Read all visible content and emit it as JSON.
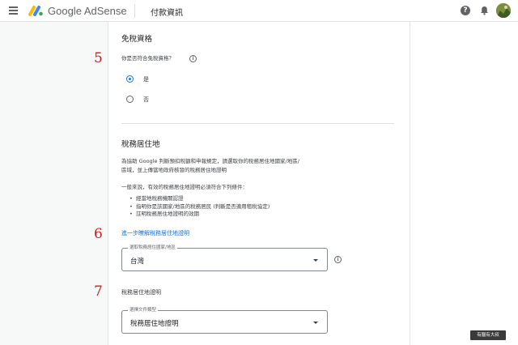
{
  "header": {
    "brand_google": "Google",
    "brand_product": "AdSense",
    "page_title": "付款資訊",
    "help_glyph": "?"
  },
  "tax_exempt": {
    "step_number": "5",
    "heading": "免稅資格",
    "question": "你是否符合免稅資格？",
    "info_glyph": "i",
    "options": [
      {
        "label": "是",
        "selected": true
      },
      {
        "label": "否",
        "selected": false
      }
    ]
  },
  "tax_residence": {
    "heading": "稅務居住地",
    "description_line1": "為協助 Google 判斷預扣稅額和申報規定，請選取你的稅務居住地國家/地區/",
    "description_line2": "區域，並上傳當地政府核發的稅務居住地證明",
    "requirements_intro": "一般來說，有效的稅務居住地證明必須符合下列條件：",
    "requirements": [
      "經當地稅務機關認證",
      "指明你是該國家/地區的稅務居民 (判斷是否適用租稅協定)",
      "註明稅務居住地證明的效期"
    ],
    "step_number": "6",
    "learn_more_link": "進一步瞭解稅務居住地證明",
    "country_select": {
      "label": "選取稅務居住國家/地區",
      "value": "台灣"
    },
    "info_glyph": "i"
  },
  "residence_certificate": {
    "step_number": "7",
    "heading": "稅務居住地證明",
    "doc_type_select": {
      "label": "選擇文件類型",
      "value": "稅務居住地證明"
    }
  },
  "watermark": "有腦有大叔",
  "colors": {
    "accent_blue": "#1a73e8",
    "step_red": "#c5221f"
  }
}
